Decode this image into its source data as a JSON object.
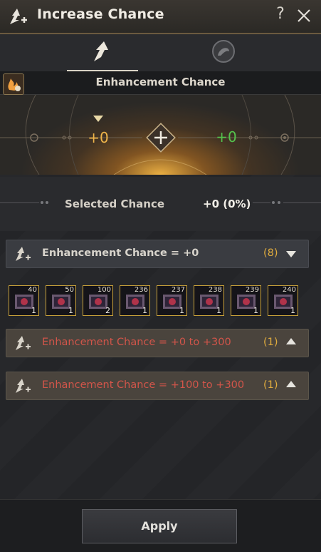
{
  "window": {
    "title": "Increase Chance",
    "help": "?"
  },
  "tabs": [
    {
      "icon": "arrow-up-icon",
      "active": true
    },
    {
      "icon": "spirit-orb-icon",
      "active": false
    }
  ],
  "section": {
    "title": "Enhancement Chance"
  },
  "dial": {
    "left_value": "+0",
    "right_value": "+0"
  },
  "selected": {
    "label": "Selected Chance",
    "value": "+0 (0%)"
  },
  "groups": [
    {
      "label": "Enhancement Chance = +0",
      "count": "(8)",
      "expanded": true
    },
    {
      "label": "Enhancement Chance = +0 to +300",
      "count": "(1)",
      "expanded": false
    },
    {
      "label": "Enhancement Chance = +100 to +300",
      "count": "(1)",
      "expanded": false
    }
  ],
  "items": [
    {
      "level": "40",
      "qty": "1"
    },
    {
      "level": "50",
      "qty": "1"
    },
    {
      "level": "100",
      "qty": "2"
    },
    {
      "level": "236",
      "qty": "1"
    },
    {
      "level": "237",
      "qty": "1"
    },
    {
      "level": "238",
      "qty": "1"
    },
    {
      "level": "239",
      "qty": "1"
    },
    {
      "level": "240",
      "qty": "1"
    }
  ],
  "footer": {
    "apply_label": "Apply"
  },
  "colors": {
    "accent_gold": "#e0ac3e",
    "positive_green": "#55c24c",
    "warning_red": "#d2554a"
  }
}
